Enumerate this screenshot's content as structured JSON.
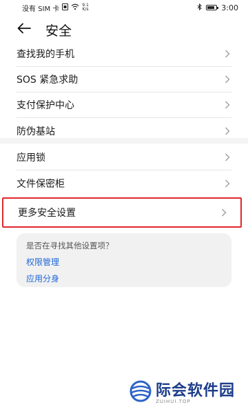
{
  "status_bar": {
    "carrier": "没有 SIM 卡",
    "speed_value": "9.1",
    "speed_unit": "K/s",
    "time": "3:00",
    "battery_level": 0.8
  },
  "header": {
    "title": "安全",
    "back_icon": "arrow-left-icon"
  },
  "group1": [
    {
      "label": "查找我的手机"
    },
    {
      "label": "SOS 紧急求助"
    },
    {
      "label": "支付保护中心"
    },
    {
      "label": "防伪基站"
    }
  ],
  "group2": [
    {
      "label": "应用锁"
    },
    {
      "label": "文件保密柜"
    }
  ],
  "highlighted_item": {
    "label": "更多安全设置",
    "highlight_color": "#e0262b"
  },
  "suggestion_card": {
    "title": "是否在寻找其他设置项？",
    "links": [
      "权限管理",
      "应用分身"
    ],
    "link_color": "#1f66d6"
  },
  "watermark": {
    "name": "际会软件园",
    "subtitle": "ZUIHUI.TOP"
  }
}
